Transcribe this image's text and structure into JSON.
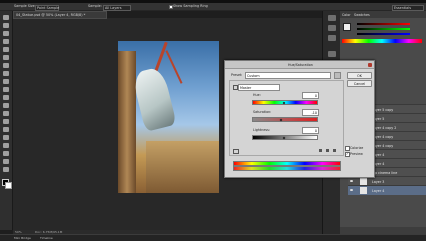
{
  "options_bar": {
    "sample_size_label": "Sample Size:",
    "sample_size_value": "Point Sample",
    "sample_label": "Sample:",
    "sample_value": "All Layers",
    "show_ring_label": "Show Sampling Ring",
    "workspace_value": "Essentials"
  },
  "document": {
    "tab_title": "04_Statue.psd @ 50% (Layer 4, RGB/8) *"
  },
  "status": {
    "zoom": "50%",
    "doc_size": "Doc: 6.75M/95.1M"
  },
  "bottom_tabs": [
    "Mini Bridge",
    "Timeline"
  ],
  "panel": {
    "tabs": [
      "Color",
      "Swatches"
    ],
    "layers": [
      {
        "name": "Layer 5 copy",
        "selected": false
      },
      {
        "name": "Layer 5",
        "selected": false
      },
      {
        "name": "Layer 4 copy 2",
        "selected": false
      },
      {
        "name": "Layer 4 copy",
        "selected": false
      },
      {
        "name": "Layer 4 copy",
        "selected": false
      },
      {
        "name": "Layer 4",
        "selected": false
      },
      {
        "name": "Layer 4",
        "selected": false
      },
      {
        "name": "hip cinema line",
        "selected": false
      },
      {
        "name": "Layer 3",
        "selected": false
      },
      {
        "name": "Layer 4",
        "selected": true
      }
    ]
  },
  "dialog": {
    "title": "Hue/Saturation",
    "preset_label": "Preset:",
    "preset_value": "Custom",
    "channel_value": "Master",
    "hue_label": "Hue:",
    "hue_value": "0",
    "hue_level": 0.5,
    "saturation_label": "Saturation:",
    "saturation_value": "-10",
    "saturation_level": 0.45,
    "lightness_label": "Lightness:",
    "lightness_value": "0",
    "lightness_level": 0.5,
    "ok_label": "OK",
    "cancel_label": "Cancel",
    "colorize_label": "Colorize",
    "preview_label": "Preview",
    "preview_checked": true
  }
}
